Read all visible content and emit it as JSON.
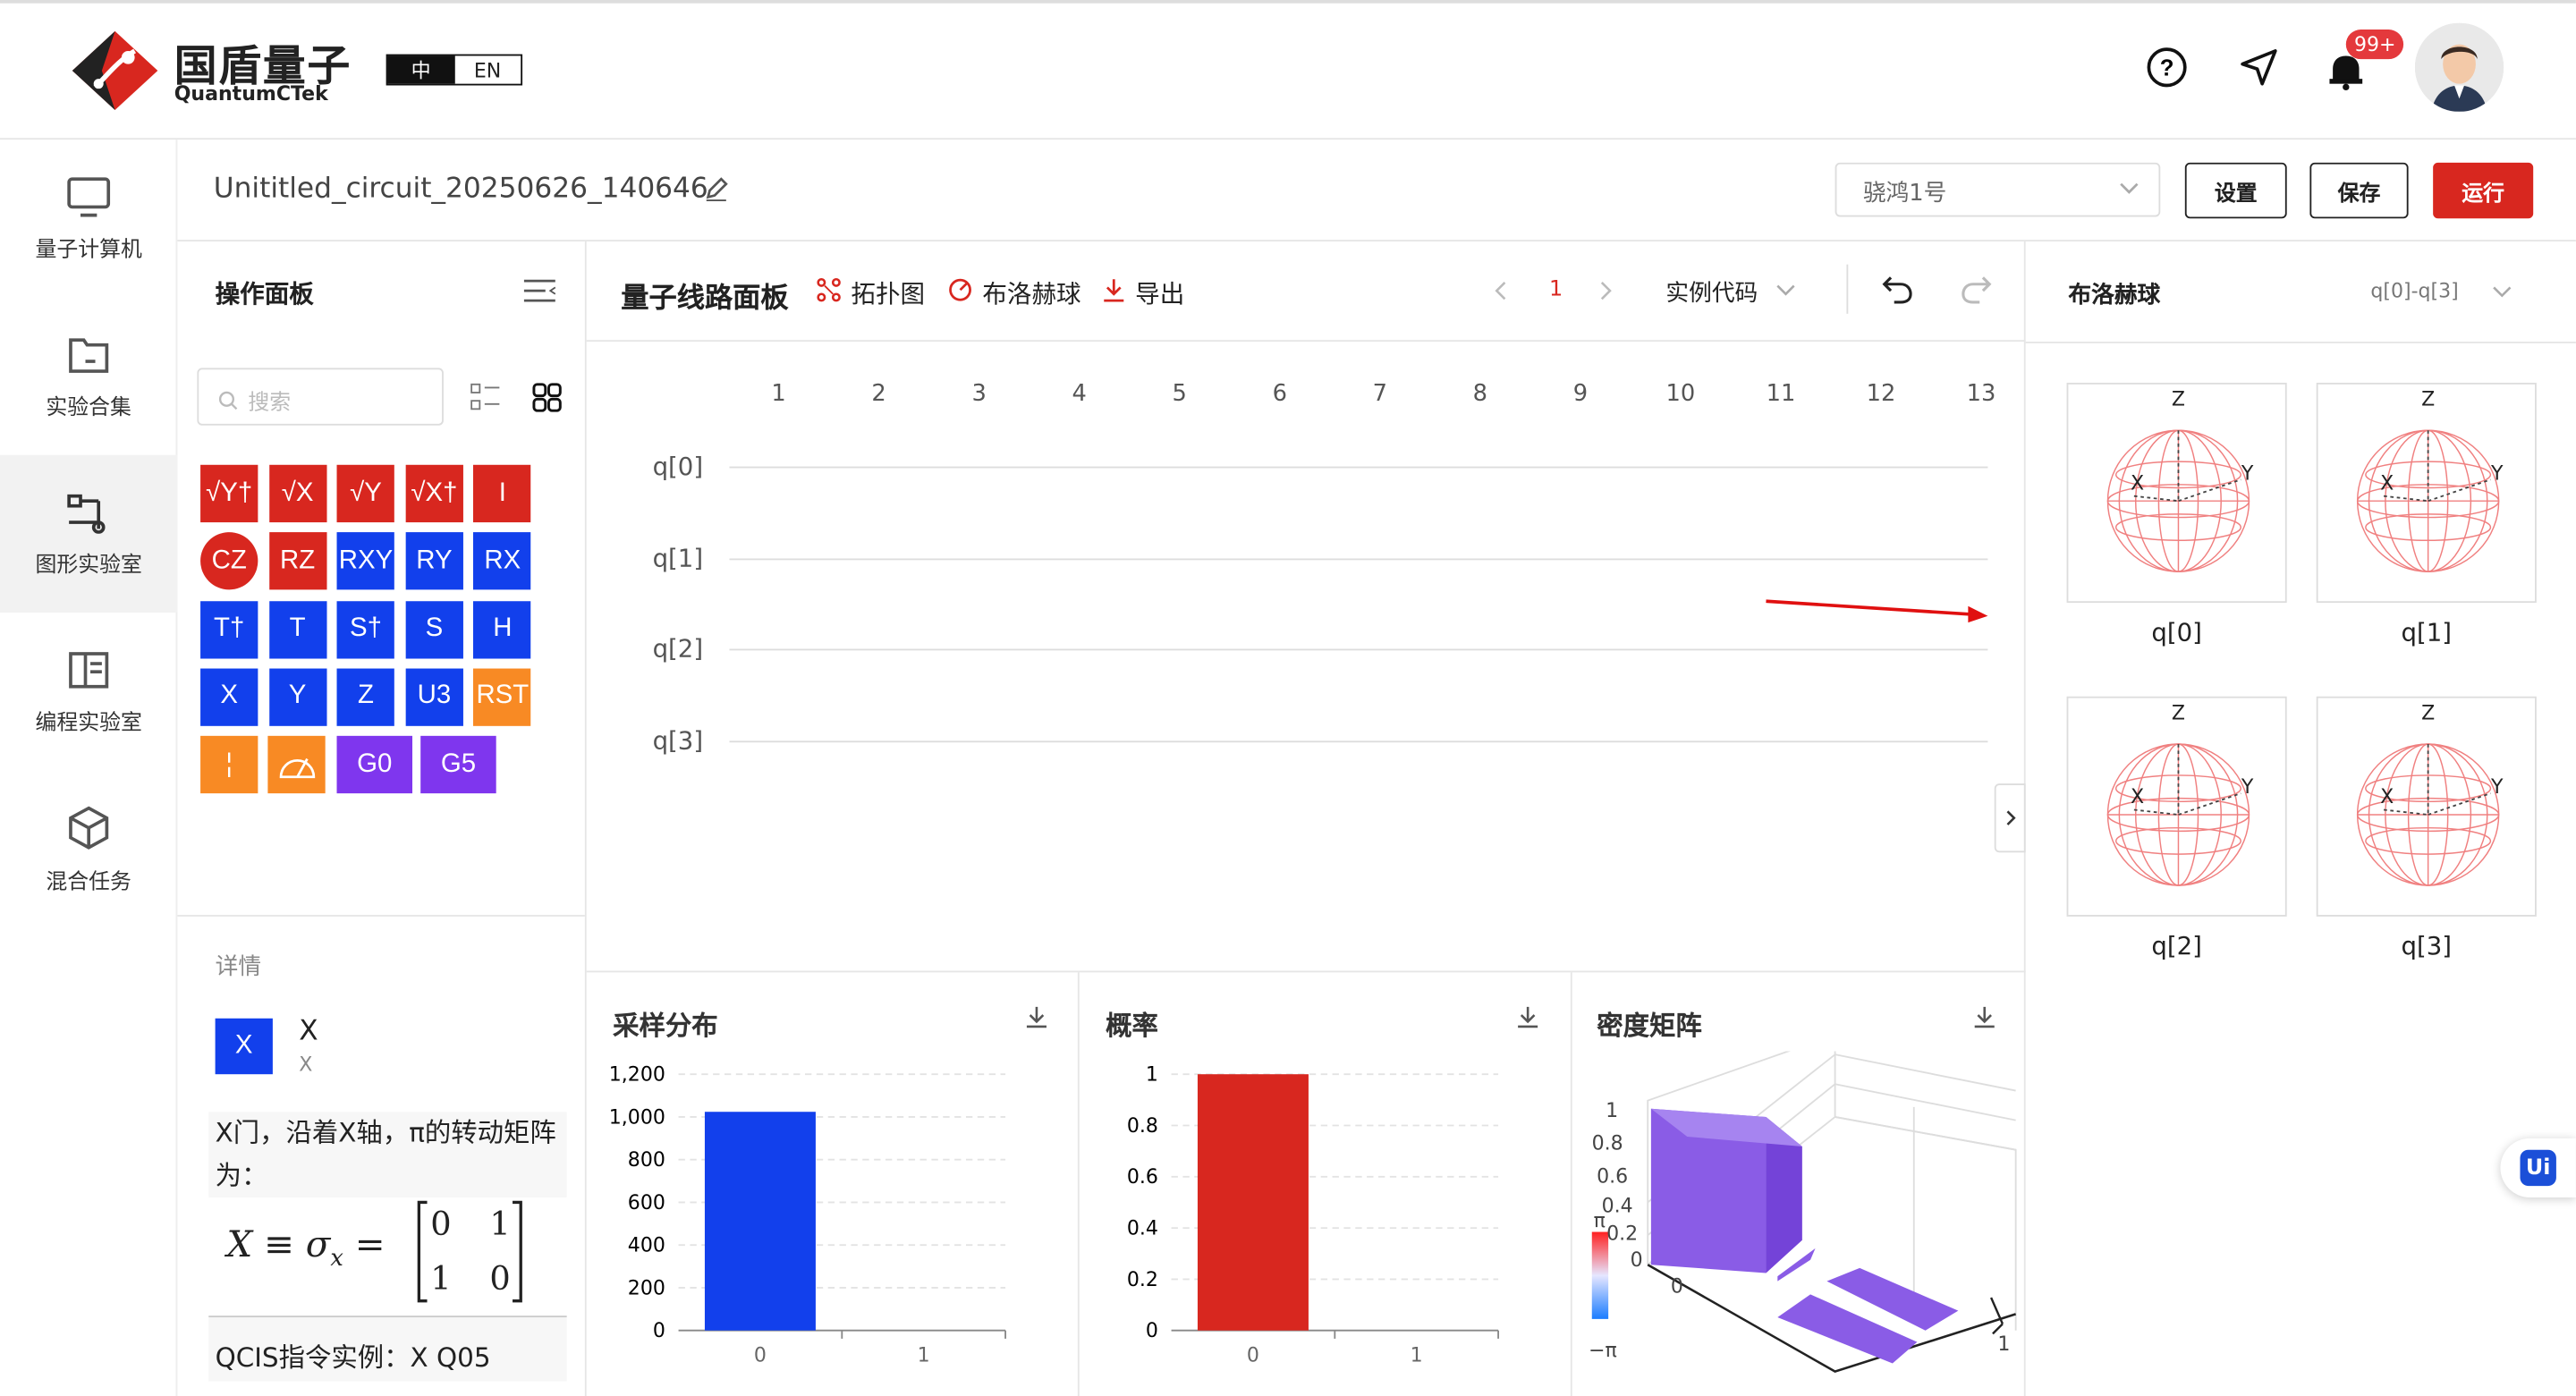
{
  "brand": {
    "name": "国盾量子",
    "sub": "QuantumCTek",
    "lang_zh": "中",
    "lang_en": "EN"
  },
  "header": {
    "badge": "99+"
  },
  "nav": [
    {
      "label": "量子计算机"
    },
    {
      "label": "实验合集"
    },
    {
      "label": "图形实验室"
    },
    {
      "label": "编程实验室"
    },
    {
      "label": "混合任务"
    }
  ],
  "circuit": {
    "title": "Unititled_circuit_20250626_140646",
    "device": "骁鸿1号",
    "settings": "设置",
    "save": "保存",
    "run": "运行"
  },
  "ops": {
    "title": "操作面板",
    "search_placeholder": "搜索",
    "gates": [
      {
        "label": "√Y†",
        "color": "red"
      },
      {
        "label": "√X",
        "color": "red"
      },
      {
        "label": "√Y",
        "color": "red"
      },
      {
        "label": "√X†",
        "color": "red"
      },
      {
        "label": "I",
        "color": "red"
      },
      {
        "label": "CZ",
        "color": "red",
        "round": true
      },
      {
        "label": "RZ",
        "color": "red"
      },
      {
        "label": "RXY",
        "color": "blue"
      },
      {
        "label": "RY",
        "color": "blue"
      },
      {
        "label": "RX",
        "color": "blue"
      },
      {
        "label": "T†",
        "color": "blue"
      },
      {
        "label": "T",
        "color": "blue"
      },
      {
        "label": "S†",
        "color": "blue"
      },
      {
        "label": "S",
        "color": "blue"
      },
      {
        "label": "H",
        "color": "blue"
      },
      {
        "label": "X",
        "color": "blue"
      },
      {
        "label": "Y",
        "color": "blue"
      },
      {
        "label": "Z",
        "color": "blue"
      },
      {
        "label": "U3",
        "color": "blue"
      },
      {
        "label": "RST",
        "color": "orange"
      },
      {
        "label": "¦",
        "color": "orange"
      },
      {
        "label": "",
        "color": "orange",
        "icon": "measure-icon"
      },
      {
        "label": "G0",
        "color": "purple"
      },
      {
        "label": "G5",
        "color": "purple"
      }
    ]
  },
  "details": {
    "title": "详情",
    "gate": "X",
    "gate_sub": "X",
    "desc": "X门，沿着X轴，π的转动矩阵为：",
    "formula_lhs": "X ≡ σ",
    "formula_sub": "x",
    "matrix": [
      "0",
      "1",
      "1",
      "0"
    ],
    "qcis": "QCIS指令实例：X Q05"
  },
  "circuit_panel": {
    "title": "量子线路面板",
    "topology": "拓扑图",
    "bloch": "布洛赫球",
    "export": "导出",
    "page": "1",
    "example": "实例代码",
    "columns": [
      "1",
      "2",
      "3",
      "4",
      "5",
      "6",
      "7",
      "8",
      "9",
      "10",
      "11",
      "12",
      "13"
    ],
    "qubits": [
      "q[0]",
      "q[1]",
      "q[2]",
      "q[3]"
    ]
  },
  "bloch_panel": {
    "title": "布洛赫球",
    "range": "q[0]-q[3]",
    "spheres": [
      "q[0]",
      "q[1]",
      "q[2]",
      "q[3]"
    ],
    "z": "Z",
    "x": "X",
    "y": "Y"
  },
  "sampling": {
    "title": "采样分布",
    "chart_data": {
      "type": "bar",
      "categories": [
        "0",
        "1"
      ],
      "values": [
        1024,
        0
      ],
      "ylim": [
        0,
        1200
      ],
      "yticks": [
        "0",
        "200",
        "400",
        "600",
        "800",
        "1,000",
        "1,200"
      ],
      "color": "#1240ec"
    }
  },
  "probability": {
    "title": "概率",
    "chart_data": {
      "type": "bar",
      "categories": [
        "0",
        "1"
      ],
      "values": [
        1,
        0
      ],
      "ylim": [
        0,
        1
      ],
      "yticks": [
        "0",
        "0.2",
        "0.4",
        "0.6",
        "0.8",
        "1"
      ],
      "color": "#d8271f"
    }
  },
  "density": {
    "title": "密度矩阵",
    "zticks": [
      "1",
      "0.8",
      "0.6",
      "0.4",
      "0.2",
      "0"
    ],
    "colorbar_max": "π",
    "colorbar_min": "−π",
    "x_tick_0": "0",
    "x_tick_1": "1"
  },
  "ui_badge": "Ui"
}
